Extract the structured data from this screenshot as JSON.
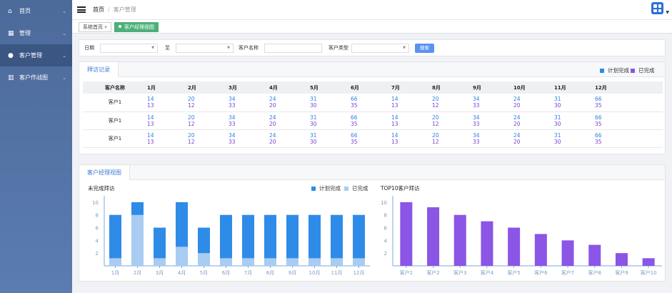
{
  "sidebar": {
    "items": [
      {
        "label": "首页",
        "icon": "home-icon"
      },
      {
        "label": "管理",
        "icon": "grid-icon"
      },
      {
        "label": "客户管理",
        "icon": "user-icon"
      },
      {
        "label": "客户作战图",
        "icon": "map-icon"
      }
    ]
  },
  "topbar": {
    "home": "首页",
    "sep": "/",
    "current": "客户管理"
  },
  "tags": {
    "system": "系统首页",
    "system_caret": "▾",
    "active": "客户经理视图"
  },
  "filter": {
    "date_label": "日期",
    "to_label": "至",
    "name_label": "客户名称",
    "type_label": "客户类型",
    "search": "搜索"
  },
  "visits": {
    "tab": "拜访记录",
    "legend": {
      "planned": "计划完成",
      "done": "已完成",
      "planned_color": "#2f8be8",
      "done_color": "#8b55e6"
    },
    "headers": [
      "客户名称",
      "1月",
      "2月",
      "3月",
      "4月",
      "5月",
      "6月",
      "7月",
      "8月",
      "9月",
      "10月",
      "11月",
      "12月"
    ],
    "rows": [
      {
        "name": "客户1",
        "planned": [
          "14",
          "20",
          "34",
          "24",
          "31",
          "66",
          "14",
          "20",
          "34",
          "24",
          "31",
          "66"
        ],
        "done": [
          "13",
          "12",
          "33",
          "20",
          "30",
          "35",
          "13",
          "12",
          "33",
          "20",
          "30",
          "35"
        ]
      },
      {
        "name": "客户1",
        "planned": [
          "14",
          "20",
          "34",
          "24",
          "31",
          "66",
          "14",
          "20",
          "34",
          "24",
          "31",
          "66"
        ],
        "done": [
          "13",
          "12",
          "33",
          "20",
          "30",
          "35",
          "13",
          "12",
          "33",
          "20",
          "30",
          "35"
        ]
      },
      {
        "name": "客户1",
        "planned": [
          "14",
          "20",
          "34",
          "24",
          "31",
          "66",
          "14",
          "20",
          "34",
          "24",
          "31",
          "66"
        ],
        "done": [
          "13",
          "12",
          "33",
          "20",
          "30",
          "35",
          "13",
          "12",
          "33",
          "20",
          "30",
          "35"
        ]
      }
    ]
  },
  "manager": {
    "tab": "客户经理视图"
  },
  "chart_data": [
    {
      "type": "bar",
      "stacked": true,
      "title": "未完成拜访",
      "categories": [
        "1月",
        "2月",
        "3月",
        "4月",
        "5月",
        "6月",
        "7月",
        "8月",
        "9月",
        "10月",
        "11月",
        "12月"
      ],
      "series": [
        {
          "name": "计划完成",
          "values": [
            8,
            10,
            6,
            10,
            6,
            8,
            8,
            8,
            8,
            8,
            8,
            8
          ],
          "color": "#2f8be8"
        },
        {
          "name": "已完成",
          "values": [
            1.2,
            8,
            1.2,
            3,
            2,
            1.2,
            1.2,
            1.2,
            1.2,
            1.2,
            1.2,
            1.2
          ],
          "color": "#a8ccf2"
        }
      ],
      "yticks": [
        2,
        4,
        6,
        8,
        10
      ],
      "ylim": [
        0,
        11
      ],
      "legend": "top-right"
    },
    {
      "type": "bar",
      "title": "TOP10客户拜访",
      "categories": [
        "客户1",
        "客户2",
        "客户3",
        "客户4",
        "客户5",
        "客户6",
        "客户7",
        "客户8",
        "客户9",
        "客户10"
      ],
      "values": [
        10,
        9.2,
        8,
        7,
        6,
        5,
        4,
        3.3,
        2,
        1.2
      ],
      "color": "#8b55e6",
      "yticks": [
        2,
        4,
        6,
        8,
        10
      ],
      "ylim": [
        0,
        11
      ]
    }
  ]
}
